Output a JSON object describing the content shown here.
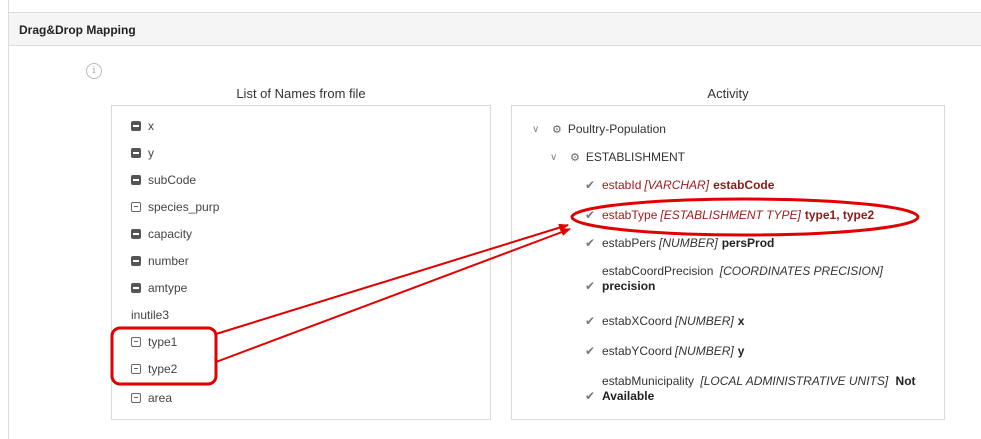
{
  "panel": {
    "title": "Drag&Drop Mapping",
    "info_glyph": "i"
  },
  "left": {
    "title": "List of Names from file",
    "items": [
      {
        "label": "x",
        "icon": "square-minus-filled-icon"
      },
      {
        "label": "y",
        "icon": "square-minus-filled-icon"
      },
      {
        "label": "subCode",
        "icon": "square-minus-filled-icon"
      },
      {
        "label": "species_purp",
        "icon": "square-minus-outline-icon"
      },
      {
        "label": "capacity",
        "icon": "square-minus-filled-icon"
      },
      {
        "label": "number",
        "icon": "square-minus-filled-icon"
      },
      {
        "label": "amtype",
        "icon": "square-minus-filled-icon"
      },
      {
        "label": "inutile3",
        "icon": ""
      },
      {
        "label": "type1",
        "icon": "square-minus-outline-icon"
      },
      {
        "label": "type2",
        "icon": "square-minus-outline-icon"
      },
      {
        "label": "area",
        "icon": "square-minus-outline-icon"
      }
    ]
  },
  "right": {
    "title": "Activity",
    "root": "Poultry-Population",
    "entity": "ESTABLISHMENT",
    "fields": [
      {
        "name": "estabId",
        "type": "[VARCHAR]",
        "mapped": "estabCode"
      },
      {
        "name": "estabType",
        "type": "[ESTABLISHMENT TYPE]",
        "mapped": "type1, type2"
      },
      {
        "name": "estabPers",
        "type": "[NUMBER]",
        "mapped": "persProd"
      },
      {
        "name": "estabCoordPrecision",
        "type": "[COORDINATES PRECISION]",
        "mapped": "precision"
      },
      {
        "name": "estabXCoord",
        "type": "[NUMBER]",
        "mapped": "x"
      },
      {
        "name": "estabYCoord",
        "type": "[NUMBER]",
        "mapped": "y"
      },
      {
        "name": "estabMunicipality",
        "type": "[LOCAL ADMINISTRATIVE UNITS]",
        "mapped": "Not Available"
      }
    ]
  },
  "icons": {
    "chevron": "∨",
    "gear": "⚙",
    "check": "✔"
  },
  "colors": {
    "annotation_red": "#e00000",
    "field_red": "#9b1b1b"
  }
}
